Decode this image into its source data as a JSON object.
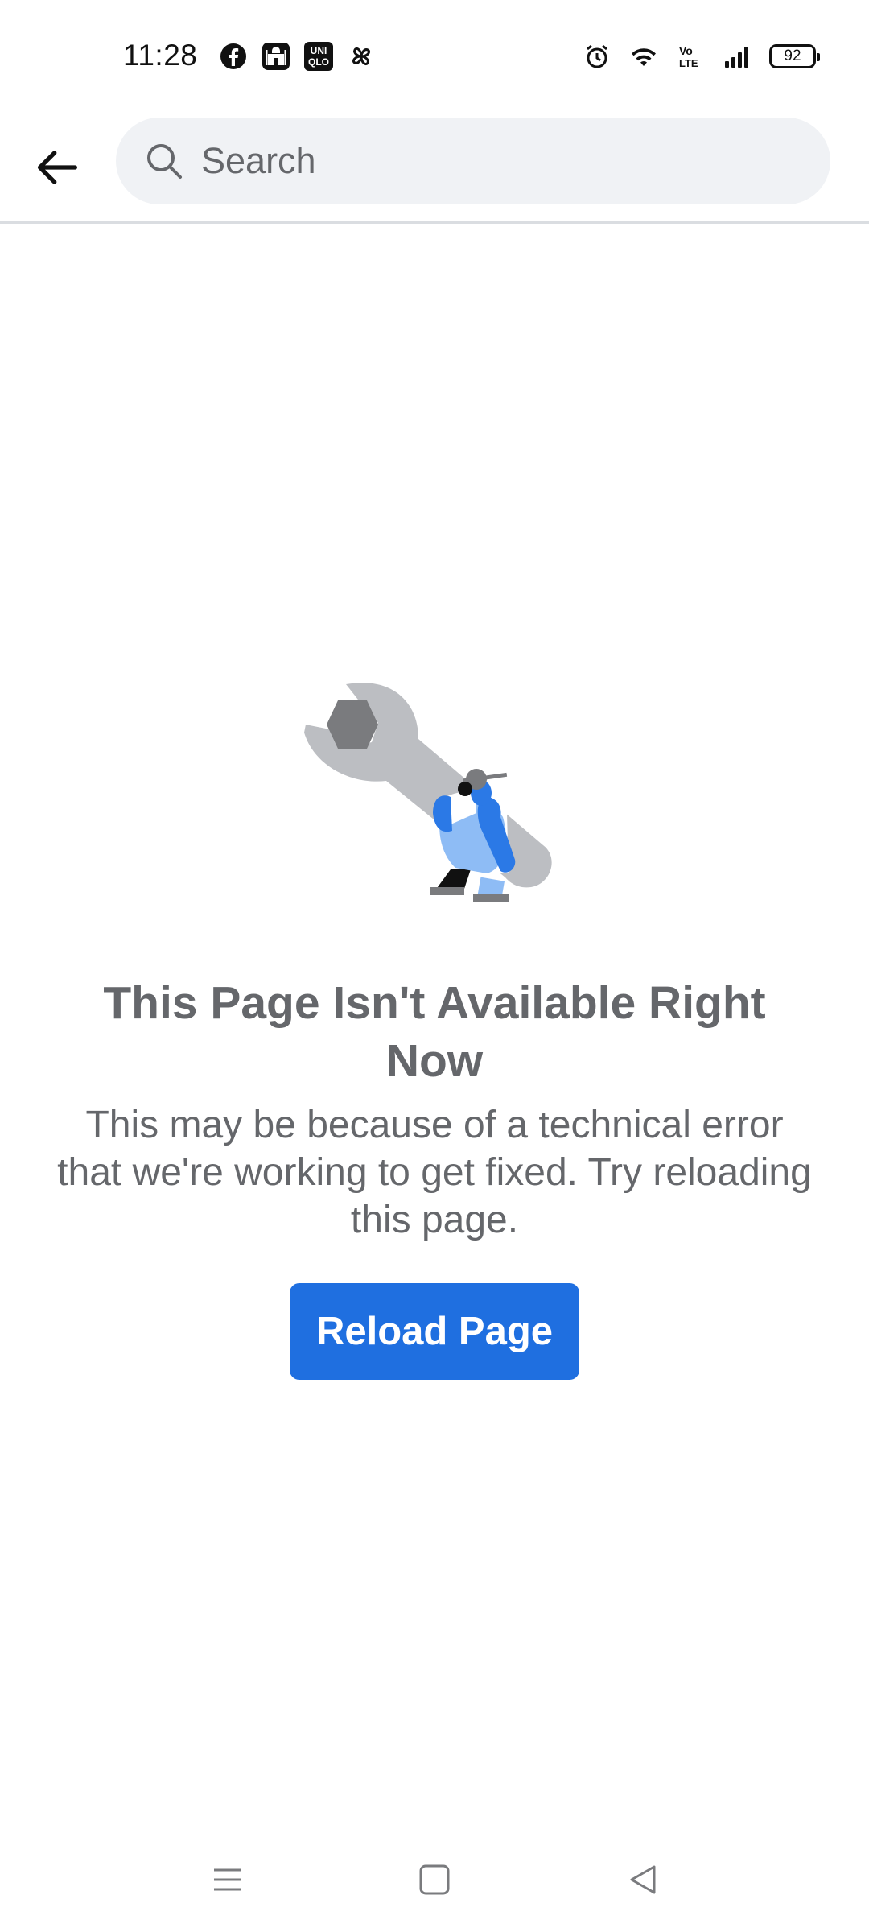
{
  "status_bar": {
    "time": "11:28",
    "left_icons": [
      "facebook-icon",
      "mosque-app-icon",
      "uniqlo-app-icon",
      "pinwheel-app-icon"
    ],
    "uniqlo_badge": [
      "UNI",
      "QLO"
    ],
    "right_icons": [
      "alarm-icon",
      "wifi-icon",
      "volte-icon",
      "signal-icon",
      "battery-icon"
    ],
    "volte_label": "Vo LTE",
    "battery_level": "92"
  },
  "header": {
    "back_icon": "arrow-left-icon",
    "search": {
      "placeholder": "Search",
      "icon": "search-icon"
    }
  },
  "main": {
    "illustration": "person-carrying-wrench-illustration",
    "title": "This Page Isn't Available Right Now",
    "message": "This may be because of a technical error that we're working to get fixed. Try reloading this page.",
    "reload_label": "Reload Page"
  },
  "nav_bar": {
    "items": [
      "menu-icon",
      "home-square-icon",
      "back-triangle-icon"
    ]
  },
  "colors": {
    "accent": "#1f6fe0",
    "text_secondary": "#65676b",
    "search_bg": "#f0f2f5",
    "divider": "#dadde1",
    "wrench": "#bcbec2",
    "hex_nut": "#7a7b7e",
    "person_blue": "#2b79e6",
    "person_light_blue": "#8ebcf5"
  }
}
